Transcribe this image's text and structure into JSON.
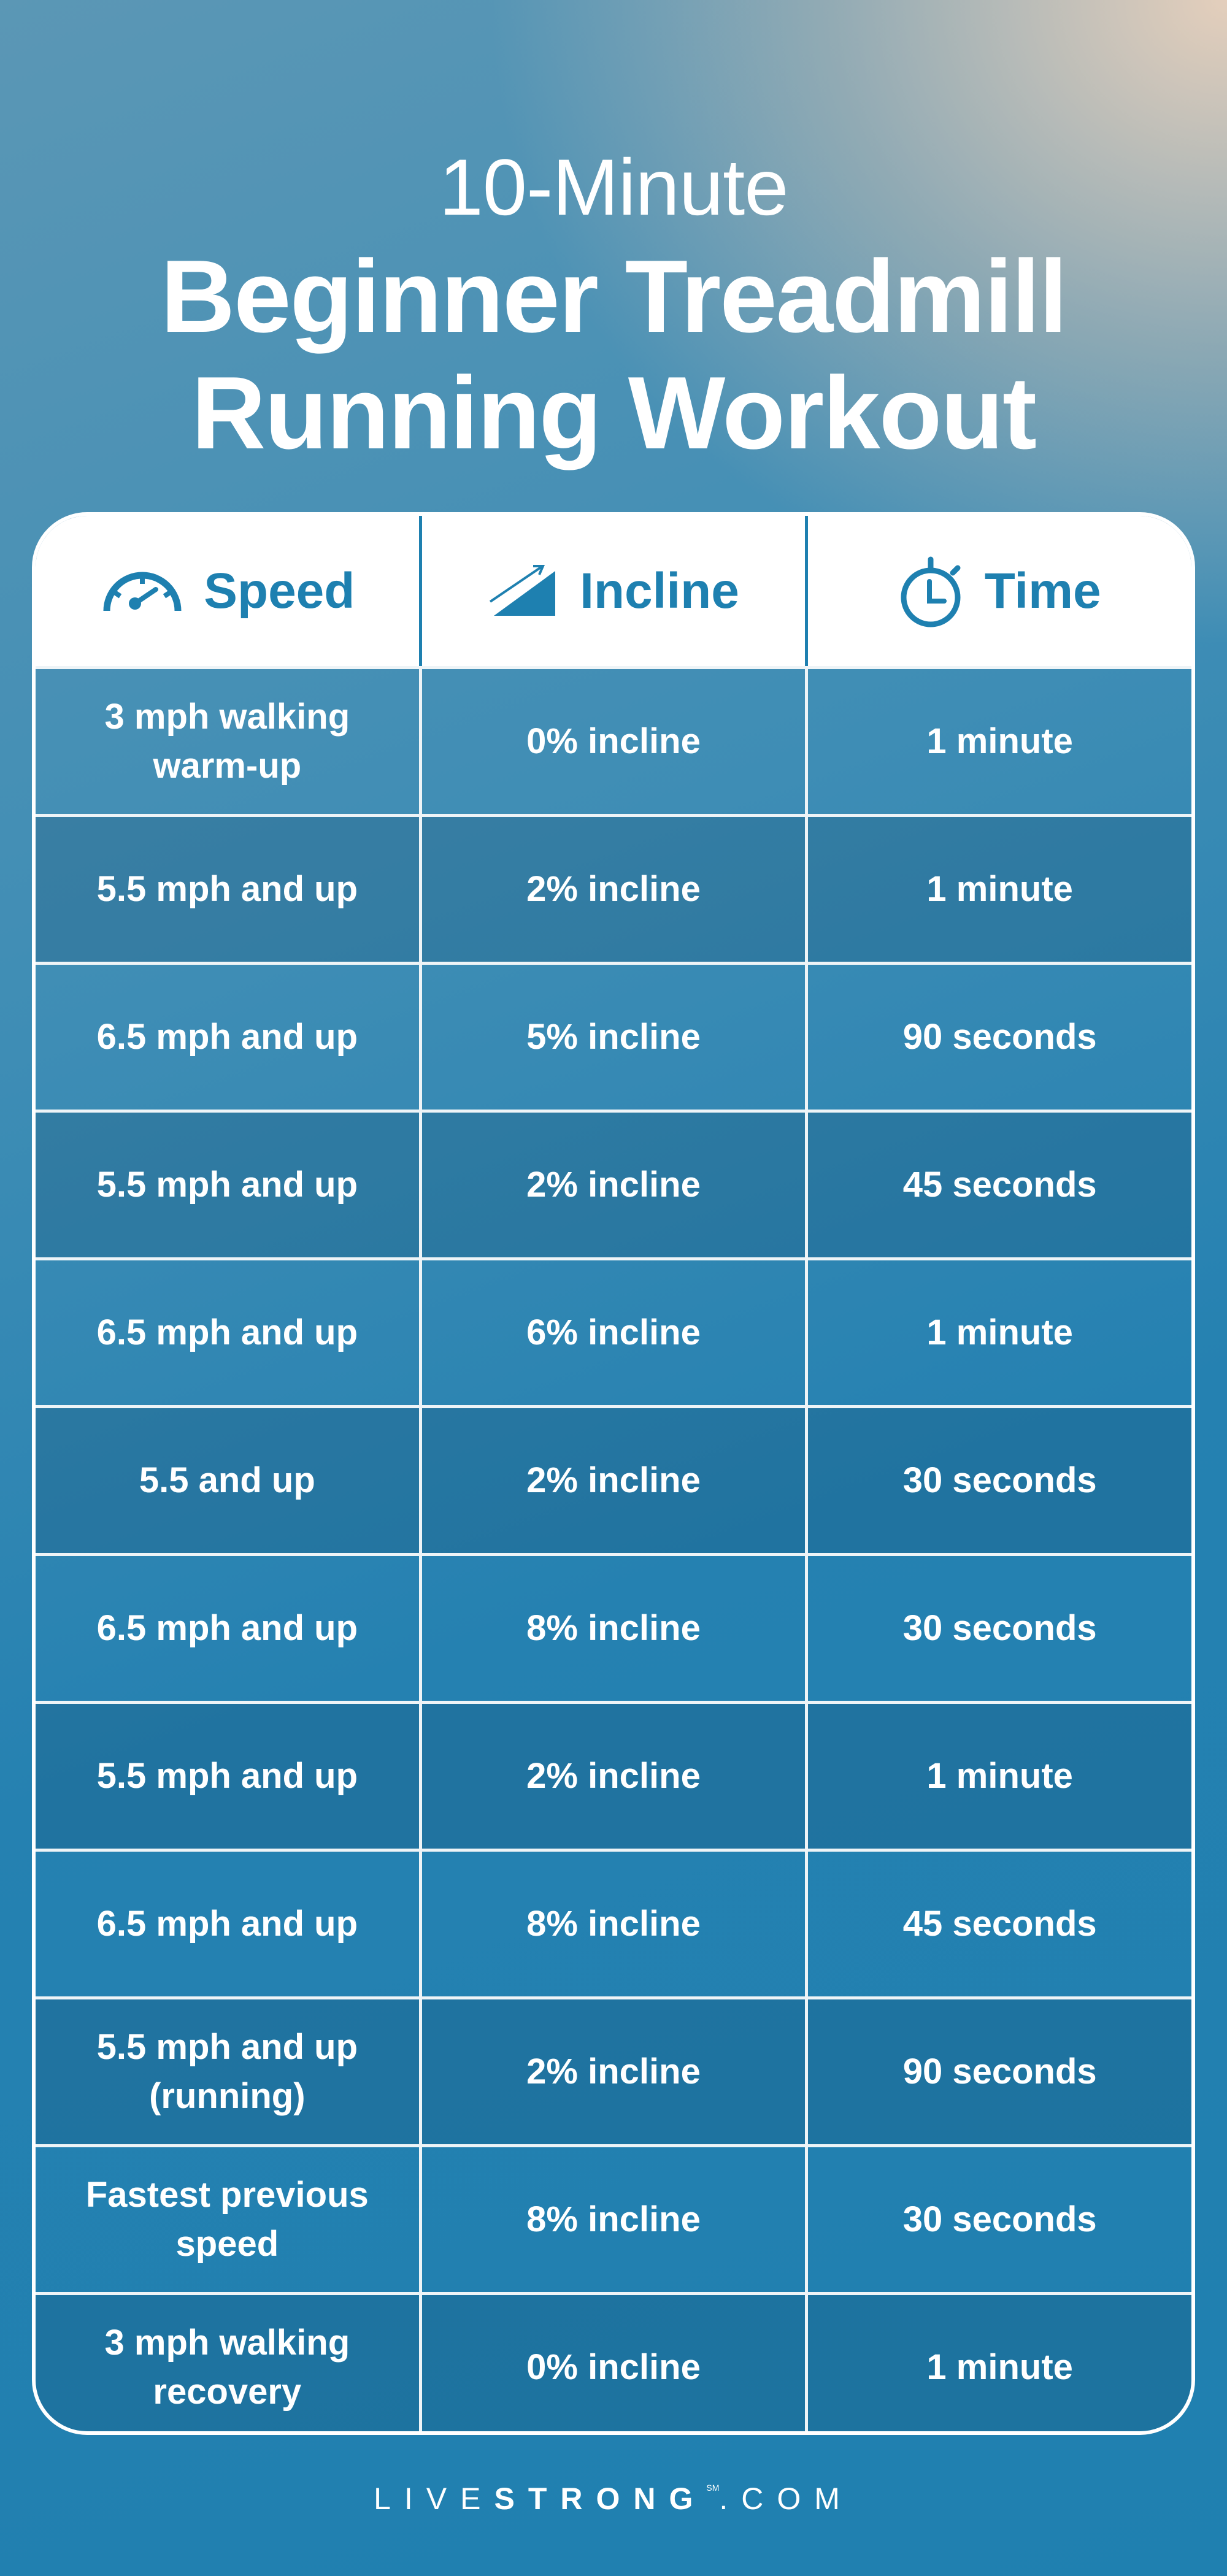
{
  "title": {
    "subtitle": "10-Minute",
    "line1": "Beginner Treadmill",
    "line2": "Running Workout"
  },
  "table": {
    "headers": [
      {
        "label": "Speed",
        "icon": "speedometer-icon"
      },
      {
        "label": "Incline",
        "icon": "incline-icon"
      },
      {
        "label": "Time",
        "icon": "stopwatch-icon"
      }
    ],
    "rows": [
      {
        "speed": "3 mph walking warm-up",
        "incline": "0% incline",
        "time": "1 minute"
      },
      {
        "speed": "5.5 mph and up",
        "incline": "2% incline",
        "time": "1 minute"
      },
      {
        "speed": "6.5 mph and up",
        "incline": "5% incline",
        "time": "90 seconds"
      },
      {
        "speed": "5.5 mph and up",
        "incline": "2% incline",
        "time": "45 seconds"
      },
      {
        "speed": "6.5 mph and up",
        "incline": "6% incline",
        "time": "1 minute"
      },
      {
        "speed": "5.5 and up",
        "incline": "2% incline",
        "time": "30 seconds"
      },
      {
        "speed": "6.5 mph and up",
        "incline": "8% incline",
        "time": "30 seconds"
      },
      {
        "speed": "5.5 mph and up",
        "incline": "2% incline",
        "time": "1 minute"
      },
      {
        "speed": "6.5 mph and up",
        "incline": "8% incline",
        "time": "45 seconds"
      },
      {
        "speed": "5.5 mph and up (running)",
        "incline": "2% incline",
        "time": "90 seconds"
      },
      {
        "speed": "Fastest previous speed",
        "incline": "8% incline",
        "time": "30 seconds"
      },
      {
        "speed": "3 mph walking recovery",
        "incline": "0% incline",
        "time": "1 minute"
      }
    ]
  },
  "footer": {
    "brand_light": "LIVE",
    "brand_bold": "STRONG",
    "mark": "SM",
    "suffix": ".COM"
  },
  "colors": {
    "accent": "#1e80b0",
    "header_bg": "#ffffff",
    "text": "#ffffff"
  }
}
